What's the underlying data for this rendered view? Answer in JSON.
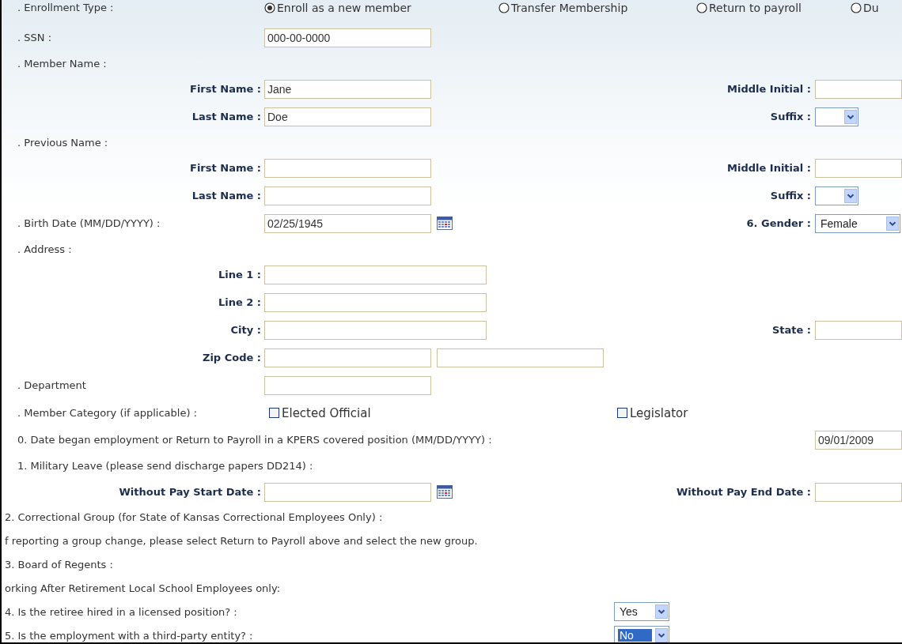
{
  "rows": [
    {
      "kind": "radio",
      "label": ". Enrollment Type :",
      "options": [
        {
          "label": "Enroll as a new member",
          "selected": true
        },
        {
          "label": "Transfer Membership",
          "selected": false
        },
        {
          "label": "Return to payroll",
          "selected": false
        },
        {
          "label": "Du",
          "selected": false
        }
      ]
    },
    {
      "kind": "field",
      "label": ". SSN :",
      "value": "000-00-0000"
    },
    {
      "kind": "heading",
      "label": ". Member Name :"
    },
    {
      "kind": "name",
      "label": "First Name :",
      "value": "Jane",
      "right": {
        "kind": "text",
        "label": "Middle Initial :"
      }
    },
    {
      "kind": "name",
      "label": "Last Name :",
      "value": "Doe",
      "right": {
        "kind": "select",
        "label": "Suffix :"
      }
    },
    {
      "kind": "heading",
      "label": ". Previous Name :"
    },
    {
      "kind": "name",
      "label": "First Name :",
      "right": {
        "kind": "text",
        "label": "Middle Initial :"
      }
    },
    {
      "kind": "name",
      "label": "Last Name :",
      "right": {
        "kind": "select",
        "label": "Suffix :"
      }
    },
    {
      "kind": "birth",
      "label": ". Birth Date (MM/DD/YYYY) :",
      "value": "02/25/1945",
      "right": {
        "kind": "select",
        "label": "6. Gender :",
        "value": "Female"
      }
    },
    {
      "kind": "heading",
      "label": ". Address :"
    },
    {
      "kind": "address",
      "label": "Line 1 :"
    },
    {
      "kind": "address",
      "label": "Line 2 :"
    },
    {
      "kind": "address",
      "label": "City :",
      "right": {
        "kind": "text",
        "label": "State :"
      }
    },
    {
      "kind": "zip",
      "label": "Zip Code :"
    },
    {
      "kind": "field",
      "label": ". Department"
    },
    {
      "kind": "checks",
      "label": ". Member Category (if applicable) :",
      "checks": [
        {
          "label": "Elected Official",
          "checked": false
        },
        {
          "label": "Legislator",
          "checked": false
        }
      ]
    },
    {
      "kind": "long_date",
      "label": "0. Date began employment or Return to Payroll in a KPERS covered position (MM/DD/YYYY) :",
      "value": "09/01/2009"
    },
    {
      "kind": "heading",
      "label": "1. Military Leave (please send discharge papers DD214) :"
    },
    {
      "kind": "dates",
      "label": "Without Pay Start Date :",
      "right": {
        "kind": "text",
        "label": "Without Pay End Date :"
      }
    },
    {
      "kind": "note",
      "label": "2. Correctional Group (for State of Kansas Correctional Employees Only) :"
    },
    {
      "kind": "note",
      "label": "f reporting a group change, please select Return to Payroll above and select the new group."
    },
    {
      "kind": "note",
      "label": "3. Board of Regents :"
    },
    {
      "kind": "note",
      "label": "orking After Retirement Local School Employees only:"
    },
    {
      "kind": "yesno",
      "label": "4. Is the retiree hired in a licensed position? :",
      "value": "Yes",
      "focused": false
    },
    {
      "kind": "yesno",
      "label": "5. Is the employment with a third-party entity? :",
      "value": "No",
      "focused": true
    }
  ]
}
